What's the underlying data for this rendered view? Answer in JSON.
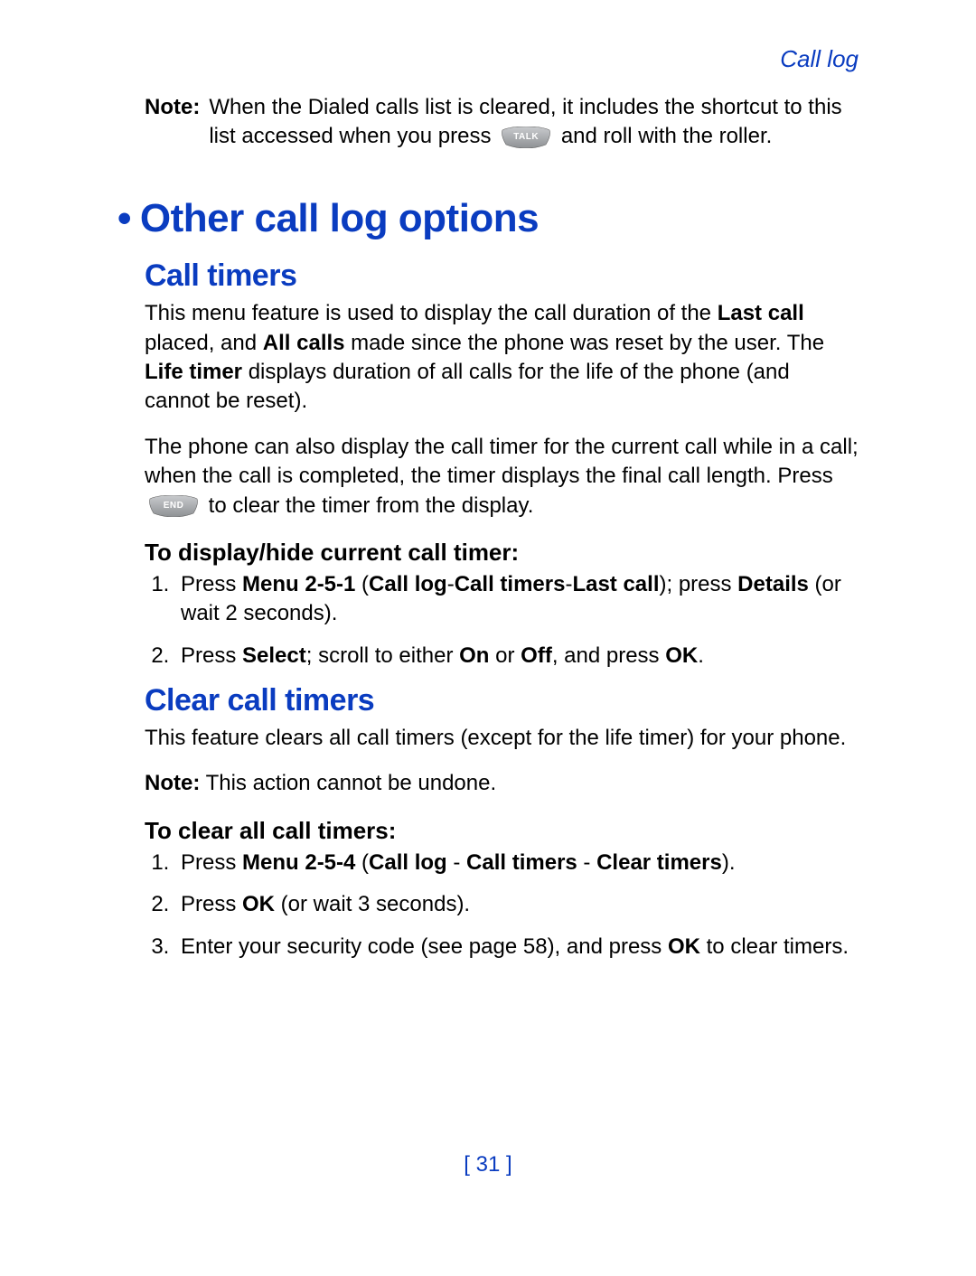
{
  "running_head": "Call log",
  "note1": {
    "label": "Note:",
    "text_before": "When the Dialed calls list is cleared, it includes the shortcut to this list accessed when you press",
    "text_after": "and roll with the roller.",
    "key": "TALK"
  },
  "h1": "Other call log options",
  "section1": {
    "h2": "Call timers",
    "para1": {
      "t1": "This menu feature is used to display the call duration of the ",
      "b1": "Last call",
      "t2": " placed, and ",
      "b2": "All calls",
      "t3": " made since the phone was reset by the user. The ",
      "b3": "Life timer",
      "t4": " displays duration of all calls for the life of the phone (and cannot be reset)."
    },
    "para2": {
      "t1": "The phone can also display the call timer for the current call while in a call; when the call is completed, the timer displays the final call length. Press",
      "key": "END",
      "t2": "to clear the timer from the display."
    },
    "h3": "To display/hide current call timer:",
    "steps": {
      "s1": {
        "t1": "Press ",
        "b1": "Menu 2-5-1",
        "t2": " (",
        "b2": "Call log",
        "t3": "-",
        "b3": "Call timers",
        "t4": "-",
        "b4": "Last call",
        "t5": "); press ",
        "b5": "Details",
        "t6": " (or wait 2 seconds)."
      },
      "s2": {
        "t1": "Press ",
        "b1": "Select",
        "t2": "; scroll to either ",
        "b2": "On",
        "t3": " or ",
        "b3": "Off",
        "t4": ", and press ",
        "b4": "OK",
        "t5": "."
      }
    }
  },
  "section2": {
    "h2": "Clear call timers",
    "para1": "This feature clears all call timers (except for the life timer) for your phone.",
    "note": {
      "label": "Note:",
      "text": "This action cannot be undone."
    },
    "h3": "To clear all call timers:",
    "steps": {
      "s1": {
        "t1": "Press ",
        "b1": "Menu 2-5-4",
        "t2": " (",
        "b2": "Call log",
        "t3": " - ",
        "b3": "Call timers",
        "t4": " - ",
        "b4": "Clear timers",
        "t5": ")."
      },
      "s2": {
        "t1": "Press ",
        "b1": "OK",
        "t2": " (or wait 3 seconds)."
      },
      "s3": {
        "t1": "Enter your security code (see page 58), and press ",
        "b1": "OK",
        "t2": " to clear timers."
      }
    }
  },
  "page_number": "31"
}
